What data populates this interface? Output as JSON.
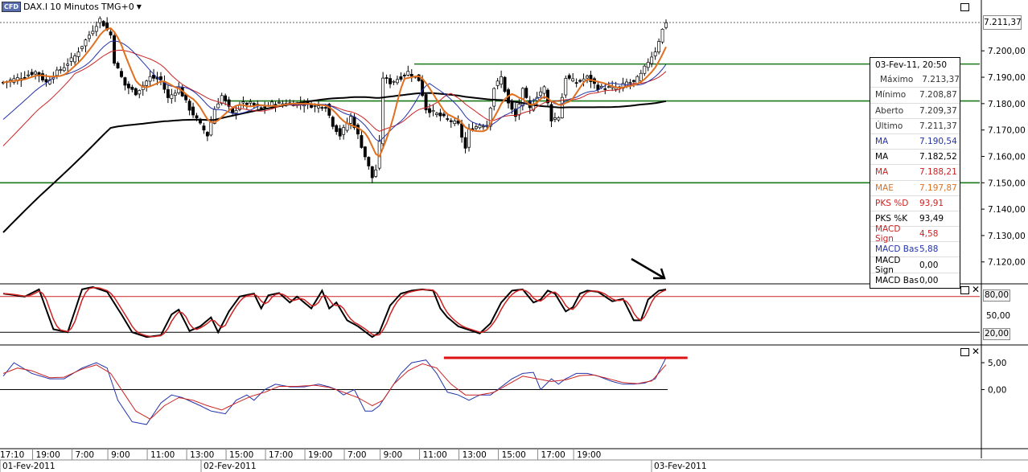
{
  "header": {
    "cfd_badge": "CFD",
    "instrument": "DAX.I",
    "interval": "10 Minutos",
    "timezone": "TMG+0",
    "menu_icon": "dropdown-triangle-icon"
  },
  "last_price": "7.211,37",
  "info_panel": {
    "datetime": "03-Fev-11, 20:50",
    "rows": [
      {
        "label": "Máximo",
        "value": "7.213,37",
        "color": "#333333"
      },
      {
        "label": "Mínimo",
        "value": "7.208,87",
        "color": "#333333"
      },
      {
        "label": "Aberto",
        "value": "7.209,37",
        "color": "#333333"
      },
      {
        "label": "Último",
        "value": "7.211,37",
        "color": "#333333"
      },
      {
        "label": "MA",
        "value": "7.190,54",
        "color": "#2233aa"
      },
      {
        "label": "MA",
        "value": "7.182,52",
        "color": "#000000"
      },
      {
        "label": "MA",
        "value": "7.188,21",
        "color": "#cc2222"
      },
      {
        "label": "MAE",
        "value": "7.197,87",
        "color": "#e07020"
      },
      {
        "label": "PKS %D",
        "value": "93,91",
        "color": "#cc2222"
      },
      {
        "label": "PKS %K",
        "value": "93,49",
        "color": "#000000"
      },
      {
        "label": "MACD Sign",
        "value": "4,58",
        "color": "#cc2222"
      },
      {
        "label": "MACD Bas",
        "value": "5,88",
        "color": "#2233aa"
      },
      {
        "label": "MACD Sign",
        "value": "0,00",
        "color": "#000000"
      },
      {
        "label": "MACD Bas",
        "value": "0,00",
        "color": "#000000"
      }
    ]
  },
  "stoch_levels": [
    "80,00",
    "50,00",
    "20,00"
  ],
  "time_labels": [
    "17:10",
    "19:00",
    "7:00",
    "9:00",
    "11:00",
    "13:00",
    "15:00",
    "17:00",
    "19:00",
    "7:00",
    "9:00",
    "11:00",
    "13:00",
    "15:00",
    "17:00",
    "19:00"
  ],
  "date_labels": [
    "01-Fev-2011",
    "02-Fev-2011",
    "03-Fev-2011"
  ],
  "chart_data": [
    {
      "type": "candlestick",
      "title": "DAX.I 10 Minutos",
      "ylim": [
        7112,
        7215
      ],
      "yticks": [
        7120,
        7130,
        7140,
        7150,
        7160,
        7170,
        7180,
        7190,
        7200
      ],
      "ytick_labels": [
        "7.120,00",
        "7.130,00",
        "7.140,00",
        "7.150,00",
        "7.160,00",
        "7.170,00",
        "7.180,00",
        "7.190,00",
        "7.200,00"
      ],
      "close_anchors": [
        [
          0,
          7188
        ],
        [
          5,
          7190
        ],
        [
          9,
          7192
        ],
        [
          12,
          7188
        ],
        [
          14,
          7191
        ],
        [
          17,
          7194
        ],
        [
          20,
          7198
        ],
        [
          24,
          7206
        ],
        [
          27,
          7212
        ],
        [
          30,
          7206
        ],
        [
          31,
          7196
        ],
        [
          34,
          7187
        ],
        [
          37,
          7184
        ],
        [
          41,
          7190
        ],
        [
          44,
          7189
        ],
        [
          46,
          7182
        ],
        [
          49,
          7186
        ],
        [
          52,
          7178
        ],
        [
          55,
          7172
        ],
        [
          57,
          7168
        ],
        [
          59,
          7178
        ],
        [
          61,
          7183
        ],
        [
          64,
          7176
        ],
        [
          66,
          7180
        ],
        [
          69,
          7180
        ],
        [
          72,
          7178
        ],
        [
          75,
          7180
        ],
        [
          78,
          7180
        ],
        [
          81,
          7180
        ],
        [
          84,
          7180
        ],
        [
          87,
          7179
        ],
        [
          90,
          7179
        ],
        [
          92,
          7172
        ],
        [
          94,
          7168
        ],
        [
          97,
          7175
        ],
        [
          99,
          7168
        ],
        [
          101,
          7160
        ],
        [
          103,
          7152
        ],
        [
          104,
          7155
        ],
        [
          105,
          7165
        ],
        [
          106,
          7190
        ],
        [
          108,
          7188
        ],
        [
          111,
          7190
        ],
        [
          113,
          7192
        ],
        [
          116,
          7189
        ],
        [
          118,
          7178
        ],
        [
          121,
          7176
        ],
        [
          124,
          7174
        ],
        [
          127,
          7172
        ],
        [
          129,
          7163
        ],
        [
          130,
          7170
        ],
        [
          133,
          7172
        ],
        [
          135,
          7172
        ],
        [
          137,
          7186
        ],
        [
          139,
          7190
        ],
        [
          141,
          7180
        ],
        [
          143,
          7175
        ],
        [
          145,
          7185
        ],
        [
          147,
          7178
        ],
        [
          149,
          7183
        ],
        [
          151,
          7186
        ],
        [
          153,
          7174
        ],
        [
          155,
          7175
        ],
        [
          157,
          7190
        ],
        [
          160,
          7188
        ],
        [
          163,
          7190
        ],
        [
          166,
          7186
        ],
        [
          168,
          7186
        ],
        [
          170,
          7186
        ],
        [
          172,
          7186
        ],
        [
          174,
          7188
        ],
        [
          176,
          7188
        ],
        [
          178,
          7191
        ],
        [
          180,
          7196
        ],
        [
          182,
          7200
        ],
        [
          184,
          7208
        ],
        [
          185,
          7211
        ]
      ],
      "horizontal_lines": [
        7150,
        7181,
        7195
      ],
      "moving_averages": [
        {
          "name": "MA",
          "color": "#2233aa",
          "value_last": 7190.54
        },
        {
          "name": "MA",
          "color": "#000000",
          "value_last": 7182.52
        },
        {
          "name": "MA",
          "color": "#cc2222",
          "value_last": 7188.21
        },
        {
          "name": "MAE",
          "color": "#e07020",
          "value_last": 7197.87
        }
      ]
    },
    {
      "type": "line",
      "title": "PKS",
      "ylim": [
        0,
        100
      ],
      "levels": [
        80,
        20
      ],
      "yticks": [
        80,
        50,
        20
      ],
      "series": [
        {
          "name": "PKS %K",
          "color": "#000000",
          "last": 93.49
        },
        {
          "name": "PKS %D",
          "color": "#cc2222",
          "last": 93.91
        }
      ],
      "k_anchors": [
        [
          0,
          85
        ],
        [
          6,
          80
        ],
        [
          10,
          92
        ],
        [
          14,
          25
        ],
        [
          18,
          20
        ],
        [
          22,
          92
        ],
        [
          25,
          96
        ],
        [
          29,
          88
        ],
        [
          33,
          50
        ],
        [
          36,
          20
        ],
        [
          40,
          12
        ],
        [
          44,
          15
        ],
        [
          47,
          50
        ],
        [
          49,
          58
        ],
        [
          52,
          22
        ],
        [
          55,
          30
        ],
        [
          58,
          45
        ],
        [
          60,
          20
        ],
        [
          63,
          55
        ],
        [
          66,
          80
        ],
        [
          70,
          85
        ],
        [
          72,
          60
        ],
        [
          74,
          82
        ],
        [
          77,
          86
        ],
        [
          80,
          70
        ],
        [
          82,
          80
        ],
        [
          86,
          60
        ],
        [
          89,
          90
        ],
        [
          91,
          60
        ],
        [
          93,
          70
        ],
        [
          96,
          40
        ],
        [
          99,
          30
        ],
        [
          103,
          12
        ],
        [
          105,
          20
        ],
        [
          108,
          65
        ],
        [
          111,
          85
        ],
        [
          114,
          90
        ],
        [
          117,
          92
        ],
        [
          120,
          90
        ],
        [
          122,
          60
        ],
        [
          124,
          45
        ],
        [
          127,
          30
        ],
        [
          131,
          22
        ],
        [
          133,
          18
        ],
        [
          136,
          35
        ],
        [
          139,
          70
        ],
        [
          142,
          90
        ],
        [
          145,
          92
        ],
        [
          148,
          70
        ],
        [
          150,
          75
        ],
        [
          152,
          90
        ],
        [
          154,
          85
        ],
        [
          157,
          55
        ],
        [
          159,
          62
        ],
        [
          161,
          85
        ],
        [
          163,
          90
        ],
        [
          166,
          88
        ],
        [
          170,
          72
        ],
        [
          173,
          76
        ],
        [
          176,
          40
        ],
        [
          178,
          40
        ],
        [
          180,
          75
        ],
        [
          183,
          90
        ],
        [
          185,
          92
        ]
      ]
    },
    {
      "type": "line",
      "title": "MACD",
      "ylim": [
        -11,
        8
      ],
      "yticks": [
        5,
        0
      ],
      "ytick_labels": [
        "5,00",
        "0,00"
      ],
      "series": [
        {
          "name": "MACD Bas",
          "color": "#2233aa",
          "last": 5.88
        },
        {
          "name": "MACD Sign",
          "color": "#cc2222",
          "last": 4.58
        }
      ],
      "bas_anchors": [
        [
          0,
          2.5
        ],
        [
          3,
          5
        ],
        [
          8,
          3
        ],
        [
          13,
          2
        ],
        [
          17,
          2
        ],
        [
          22,
          4
        ],
        [
          26,
          5
        ],
        [
          29,
          4
        ],
        [
          32,
          -2
        ],
        [
          36,
          -6
        ],
        [
          40,
          -6.5
        ],
        [
          44,
          -2.5
        ],
        [
          47,
          -1
        ],
        [
          50,
          -1.5
        ],
        [
          55,
          -3
        ],
        [
          58,
          -4
        ],
        [
          62,
          -4.5
        ],
        [
          65,
          -2
        ],
        [
          68,
          -1
        ],
        [
          70,
          -2
        ],
        [
          73,
          0
        ],
        [
          76,
          1
        ],
        [
          80,
          0.5
        ],
        [
          84,
          0.5
        ],
        [
          88,
          1
        ],
        [
          91,
          0.5
        ],
        [
          93,
          0
        ],
        [
          95,
          -1
        ],
        [
          98,
          0
        ],
        [
          101,
          -4
        ],
        [
          103,
          -4
        ],
        [
          105,
          -3
        ],
        [
          108,
          0
        ],
        [
          111,
          3
        ],
        [
          114,
          5
        ],
        [
          118,
          5.5
        ],
        [
          121,
          3
        ],
        [
          124,
          -0.5
        ],
        [
          127,
          -1
        ],
        [
          130,
          -2
        ],
        [
          133,
          -1
        ],
        [
          136,
          -1
        ],
        [
          139,
          0.5
        ],
        [
          142,
          2
        ],
        [
          145,
          3
        ],
        [
          148,
          3.2
        ],
        [
          150,
          0
        ],
        [
          153,
          2
        ],
        [
          155,
          1
        ],
        [
          157,
          2
        ],
        [
          160,
          3
        ],
        [
          163,
          3
        ],
        [
          166,
          2.5
        ],
        [
          170,
          1.5
        ],
        [
          173,
          1
        ],
        [
          176,
          1
        ],
        [
          179,
          1.2
        ],
        [
          182,
          2
        ],
        [
          185,
          5.9
        ]
      ],
      "signal_anchors": [
        [
          0,
          3
        ],
        [
          4,
          4
        ],
        [
          8,
          3.5
        ],
        [
          13,
          2.2
        ],
        [
          17,
          2.3
        ],
        [
          22,
          3.8
        ],
        [
          26,
          4.6
        ],
        [
          30,
          3
        ],
        [
          33,
          0
        ],
        [
          37,
          -4
        ],
        [
          41,
          -5.5
        ],
        [
          45,
          -3
        ],
        [
          49,
          -1.5
        ],
        [
          53,
          -2
        ],
        [
          57,
          -3
        ],
        [
          61,
          -3.8
        ],
        [
          65,
          -2.5
        ],
        [
          69,
          -1.3
        ],
        [
          73,
          -0.5
        ],
        [
          77,
          0.6
        ],
        [
          82,
          0.6
        ],
        [
          87,
          0.8
        ],
        [
          91,
          0.4
        ],
        [
          95,
          -0.5
        ],
        [
          99,
          -1.5
        ],
        [
          103,
          -3
        ],
        [
          106,
          -2
        ],
        [
          109,
          1
        ],
        [
          113,
          3.5
        ],
        [
          117,
          4.8
        ],
        [
          121,
          4
        ],
        [
          125,
          1
        ],
        [
          129,
          -1
        ],
        [
          133,
          -1
        ],
        [
          137,
          -0.5
        ],
        [
          141,
          1
        ],
        [
          145,
          2.5
        ],
        [
          149,
          2
        ],
        [
          153,
          1.5
        ],
        [
          157,
          1.8
        ],
        [
          161,
          2.6
        ],
        [
          165,
          2.7
        ],
        [
          169,
          2
        ],
        [
          173,
          1.3
        ],
        [
          177,
          1.1
        ],
        [
          181,
          1.6
        ],
        [
          185,
          4.6
        ]
      ],
      "annotation_line": {
        "y": 5.9,
        "x_from": 123,
        "x_to": 191,
        "color": "#dd1111"
      }
    }
  ],
  "colors": {
    "level_green": "#1a7a1a",
    "up_candle": "#ffffff",
    "down_candle": "#000000"
  }
}
